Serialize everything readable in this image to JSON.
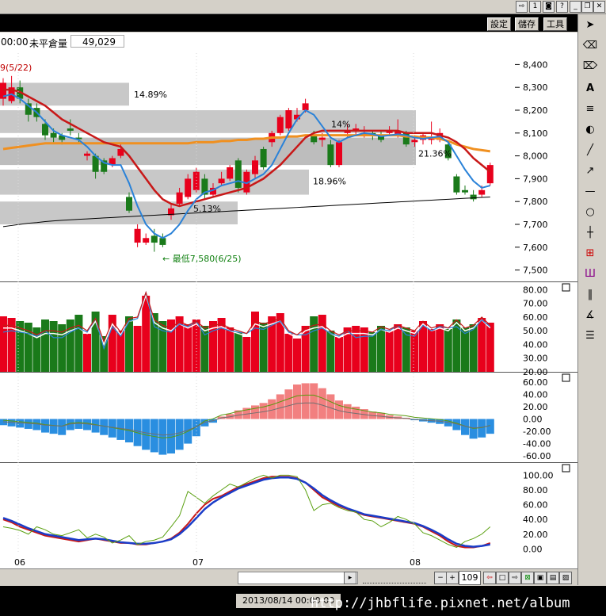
{
  "info": {
    "time_fragment": "00:00",
    "open_interest_label": "未平倉量",
    "open_interest_value": "49,029",
    "period_label": "9(5/22)"
  },
  "toolbar_top": {
    "settings": "設定",
    "save": "儲存",
    "tools": "工具"
  },
  "zoom_value": "109",
  "status": {
    "datetime": "2013/08/14 00:00:00",
    "watermark": "http://jhbflife.pixnet.net/album"
  },
  "colors": {
    "up": "#e8001c",
    "down": "#1a7a1a",
    "ma_short": "#2a82d8",
    "ma_mid": "#c81818",
    "ma_long": "#f09020",
    "ma_year": "#000000",
    "band": "#c8c8c8",
    "macd_pos": "#f28080",
    "macd_neg": "#2a8ee0"
  },
  "chart_data": [
    {
      "type": "candlestick",
      "title": "",
      "ylim": [
        7450,
        8450
      ],
      "y_ticks": [
        "8,400",
        "8,300",
        "8,200",
        "8,100",
        "8,000",
        "7,900",
        "7,800",
        "7,700",
        "7,600",
        "7,500"
      ],
      "x_ticks": [
        "06",
        "07",
        "08"
      ],
      "annotations": [
        "14.89%",
        "14%",
        "21.36%",
        "18.96%",
        "5.13%",
        "最低7,580(6/25)"
      ],
      "candles": [
        {
          "o": 8250,
          "c": 8320,
          "h": 8340,
          "l": 8220
        },
        {
          "o": 8240,
          "c": 8300,
          "h": 8350,
          "l": 8230
        },
        {
          "o": 8300,
          "c": 8250,
          "h": 8330,
          "l": 8230
        },
        {
          "o": 8230,
          "c": 8180,
          "h": 8250,
          "l": 8150
        },
        {
          "o": 8210,
          "c": 8170,
          "h": 8230,
          "l": 8150
        },
        {
          "o": 8140,
          "c": 8090,
          "h": 8160,
          "l": 8070
        },
        {
          "o": 8100,
          "c": 8080,
          "h": 8120,
          "l": 8060
        },
        {
          "o": 8090,
          "c": 8070,
          "h": 8100,
          "l": 8050
        },
        {
          "o": 8120,
          "c": 8110,
          "h": 8160,
          "l": 8090
        },
        {
          "o": 8080,
          "c": 8075,
          "h": 8100,
          "l": 8060
        },
        {
          "o": 8000,
          "c": 8010,
          "h": 8020,
          "l": 7980
        },
        {
          "o": 8000,
          "c": 7930,
          "h": 8010,
          "l": 7900
        },
        {
          "o": 7980,
          "c": 7930,
          "h": 7990,
          "l": 7920
        },
        {
          "o": 7960,
          "c": 7990,
          "h": 8000,
          "l": 7950
        },
        {
          "o": 8000,
          "c": 8030,
          "h": 8050,
          "l": 7990
        },
        {
          "o": 7820,
          "c": 7760,
          "h": 7840,
          "l": 7750
        },
        {
          "o": 7620,
          "c": 7680,
          "h": 7700,
          "l": 7600
        },
        {
          "o": 7620,
          "c": 7640,
          "h": 7660,
          "l": 7610
        },
        {
          "o": 7650,
          "c": 7620,
          "h": 7680,
          "l": 7580
        },
        {
          "o": 7640,
          "c": 7610,
          "h": 7660,
          "l": 7600
        },
        {
          "o": 7740,
          "c": 7770,
          "h": 7790,
          "l": 7720
        },
        {
          "o": 7790,
          "c": 7840,
          "h": 7860,
          "l": 7780
        },
        {
          "o": 7820,
          "c": 7900,
          "h": 7920,
          "l": 7810
        },
        {
          "o": 7850,
          "c": 7930,
          "h": 7950,
          "l": 7840
        },
        {
          "o": 7900,
          "c": 7830,
          "h": 7920,
          "l": 7810
        },
        {
          "o": 7830,
          "c": 7860,
          "h": 7880,
          "l": 7820
        },
        {
          "o": 7880,
          "c": 7900,
          "h": 7930,
          "l": 7870
        },
        {
          "o": 7900,
          "c": 7950,
          "h": 7960,
          "l": 7890
        },
        {
          "o": 7980,
          "c": 7860,
          "h": 7990,
          "l": 7840
        },
        {
          "o": 7840,
          "c": 7930,
          "h": 7940,
          "l": 7830
        },
        {
          "o": 7920,
          "c": 7980,
          "h": 8000,
          "l": 7900
        },
        {
          "o": 8030,
          "c": 7950,
          "h": 8040,
          "l": 7940
        },
        {
          "o": 8060,
          "c": 8100,
          "h": 8110,
          "l": 8040
        },
        {
          "o": 8100,
          "c": 8170,
          "h": 8180,
          "l": 8090
        },
        {
          "o": 8120,
          "c": 8200,
          "h": 8210,
          "l": 8110
        },
        {
          "o": 8160,
          "c": 8180,
          "h": 8210,
          "l": 8150
        },
        {
          "o": 8200,
          "c": 8230,
          "h": 8250,
          "l": 8190
        },
        {
          "o": 8090,
          "c": 8060,
          "h": 8110,
          "l": 8050
        },
        {
          "o": 8070,
          "c": 8080,
          "h": 8100,
          "l": 8040
        },
        {
          "o": 8050,
          "c": 7960,
          "h": 8070,
          "l": 7950
        },
        {
          "o": 7960,
          "c": 8060,
          "h": 8070,
          "l": 7950
        },
        {
          "o": 8100,
          "c": 8110,
          "h": 8140,
          "l": 8080
        },
        {
          "o": 8110,
          "c": 8120,
          "h": 8140,
          "l": 8090
        },
        {
          "o": 8090,
          "c": 8100,
          "h": 8130,
          "l": 8080
        },
        {
          "o": 8100,
          "c": 8090,
          "h": 8110,
          "l": 8070
        },
        {
          "o": 8090,
          "c": 8070,
          "h": 8110,
          "l": 8060
        },
        {
          "o": 8100,
          "c": 8110,
          "h": 8130,
          "l": 8090
        },
        {
          "o": 8090,
          "c": 8110,
          "h": 8160,
          "l": 8080
        },
        {
          "o": 8100,
          "c": 8050,
          "h": 8110,
          "l": 8040
        },
        {
          "o": 8060,
          "c": 8070,
          "h": 8090,
          "l": 8040
        },
        {
          "o": 8070,
          "c": 8090,
          "h": 8100,
          "l": 8050
        },
        {
          "o": 8070,
          "c": 8080,
          "h": 8150,
          "l": 8050
        },
        {
          "o": 8070,
          "c": 8100,
          "h": 8120,
          "l": 8060
        },
        {
          "o": 8050,
          "c": 7990,
          "h": 8060,
          "l": 7980
        },
        {
          "o": 7910,
          "c": 7840,
          "h": 7920,
          "l": 7830
        },
        {
          "o": 7850,
          "c": 7840,
          "h": 7870,
          "l": 7830
        },
        {
          "o": 7830,
          "c": 7810,
          "h": 7850,
          "l": 7800
        },
        {
          "o": 7830,
          "c": 7850,
          "h": 7870,
          "l": 7820
        },
        {
          "o": 7880,
          "c": 7960,
          "h": 7970,
          "l": 7870
        }
      ],
      "ma_short": [
        8260,
        8270,
        8250,
        8220,
        8190,
        8150,
        8110,
        8090,
        8080,
        8070,
        8040,
        8000,
        7970,
        7960,
        7960,
        7880,
        7780,
        7700,
        7660,
        7640,
        7660,
        7700,
        7760,
        7810,
        7840,
        7850,
        7870,
        7880,
        7890,
        7880,
        7900,
        7920,
        7960,
        8030,
        8100,
        8160,
        8200,
        8180,
        8130,
        8080,
        8060,
        8080,
        8090,
        8100,
        8095,
        8085,
        8090,
        8095,
        8090,
        8080,
        8075,
        8080,
        8085,
        8060,
        8000,
        7940,
        7890,
        7860,
        7870
      ],
      "ma_mid": [
        8290,
        8290,
        8280,
        8260,
        8240,
        8220,
        8190,
        8160,
        8140,
        8120,
        8100,
        8080,
        8060,
        8050,
        8040,
        8000,
        7950,
        7900,
        7850,
        7810,
        7790,
        7780,
        7790,
        7800,
        7810,
        7820,
        7830,
        7840,
        7850,
        7860,
        7880,
        7900,
        7930,
        7960,
        8000,
        8040,
        8080,
        8100,
        8110,
        8110,
        8110,
        8110,
        8110,
        8110,
        8110,
        8110,
        8110,
        8110,
        8100,
        8100,
        8100,
        8100,
        8090,
        8080,
        8060,
        8030,
        7990,
        7960,
        7930
      ],
      "ma_long": [
        8030,
        8035,
        8040,
        8045,
        8050,
        8055,
        8055,
        8055,
        8055,
        8055,
        8055,
        8055,
        8055,
        8055,
        8055,
        8055,
        8055,
        8055,
        8055,
        8055,
        8055,
        8055,
        8055,
        8060,
        8060,
        8060,
        8065,
        8065,
        8070,
        8070,
        8075,
        8075,
        8080,
        8080,
        8085,
        8085,
        8090,
        8090,
        8090,
        8090,
        8090,
        8090,
        8090,
        8090,
        8090,
        8090,
        8090,
        8090,
        8085,
        8085,
        8080,
        8080,
        8075,
        8065,
        8050,
        8040,
        8030,
        8025,
        8020
      ],
      "ma_year": [
        7690,
        7695,
        7700,
        7705,
        7708,
        7712,
        7715,
        7718,
        7720,
        7722,
        7724,
        7726,
        7728,
        7730,
        7732,
        7734,
        7736,
        7738,
        7740,
        7742,
        7744,
        7746,
        7748,
        7750,
        7752,
        7754,
        7756,
        7758,
        7760,
        7762,
        7764,
        7766,
        7768,
        7770,
        7772,
        7774,
        7776,
        7778,
        7780,
        7782,
        7784,
        7786,
        7788,
        7790,
        7792,
        7794,
        7796,
        7798,
        7800,
        7802,
        7804,
        7806,
        7808,
        7810,
        7812,
        7814,
        7816,
        7818,
        7820
      ]
    },
    {
      "type": "bar",
      "title": "",
      "ylim": [
        20,
        82
      ],
      "y_ticks": [
        "80.00",
        "70.00",
        "60.00",
        "50.00",
        "40.00",
        "30.00",
        "20.00"
      ],
      "values": [
        52,
        52,
        50,
        48,
        45,
        48,
        48,
        47,
        50,
        52,
        48,
        57,
        40,
        55,
        47,
        57,
        58,
        76,
        56,
        52,
        50,
        55,
        52,
        55,
        50,
        52,
        53,
        50,
        48,
        46,
        55,
        53,
        55,
        57,
        48,
        45,
        50,
        52,
        53,
        48,
        45,
        48,
        48,
        48,
        47,
        51,
        49,
        52,
        50,
        48,
        55,
        50,
        52,
        50,
        56,
        50,
        52,
        58,
        52
      ]
    },
    {
      "type": "bar",
      "title": "",
      "ylim": [
        -65,
        65
      ],
      "y_ticks": [
        "60.00",
        "40.00",
        "20.00",
        "0.00",
        "-20.00",
        "-40.00",
        "-60.00"
      ],
      "values": [
        -10,
        -12,
        -14,
        -16,
        -18,
        -22,
        -24,
        -26,
        -18,
        -16,
        -18,
        -22,
        -26,
        -30,
        -34,
        -38,
        -44,
        -50,
        -54,
        -58,
        -56,
        -50,
        -40,
        -28,
        -12,
        -6,
        4,
        8,
        14,
        18,
        22,
        26,
        32,
        40,
        48,
        56,
        58,
        58,
        50,
        40,
        30,
        24,
        20,
        16,
        12,
        10,
        6,
        4,
        2,
        -2,
        -4,
        -6,
        -8,
        -12,
        -18,
        -26,
        -32,
        -30,
        -24
      ]
    },
    {
      "type": "line",
      "title": "",
      "ylim": [
        -5,
        108
      ],
      "y_ticks": [
        "100.00",
        "80.00",
        "60.00",
        "40.00",
        "20.00",
        "0.00"
      ],
      "series": [
        {
          "values": [
            40,
            36,
            30,
            26,
            22,
            18,
            16,
            14,
            12,
            10,
            12,
            14,
            12,
            10,
            8,
            8,
            6,
            6,
            8,
            10,
            14,
            22,
            34,
            48,
            60,
            68,
            72,
            78,
            84,
            88,
            92,
            96,
            98,
            98,
            98,
            96,
            90,
            80,
            70,
            64,
            58,
            54,
            50,
            46,
            44,
            42,
            40,
            38,
            36,
            34,
            30,
            24,
            18,
            10,
            4,
            2,
            2,
            4,
            8
          ]
        },
        {
          "values": [
            42,
            38,
            33,
            28,
            24,
            20,
            18,
            16,
            14,
            12,
            13,
            14,
            13,
            11,
            9,
            8,
            7,
            7,
            8,
            10,
            13,
            20,
            30,
            42,
            54,
            63,
            70,
            76,
            82,
            86,
            90,
            94,
            96,
            97,
            97,
            95,
            90,
            82,
            73,
            66,
            60,
            55,
            51,
            47,
            45,
            43,
            41,
            39,
            37,
            35,
            31,
            26,
            20,
            13,
            7,
            4,
            3,
            4,
            6
          ]
        },
        {
          "values": [
            30,
            28,
            25,
            20,
            30,
            26,
            20,
            18,
            22,
            26,
            15,
            20,
            16,
            8,
            12,
            18,
            6,
            10,
            12,
            16,
            30,
            45,
            78,
            70,
            62,
            72,
            80,
            88,
            84,
            90,
            96,
            100,
            96,
            100,
            100,
            98,
            80,
            52,
            60,
            62,
            56,
            52,
            50,
            40,
            38,
            30,
            36,
            44,
            40,
            34,
            22,
            18,
            12,
            6,
            2,
            10,
            14,
            20,
            30
          ]
        }
      ]
    }
  ]
}
